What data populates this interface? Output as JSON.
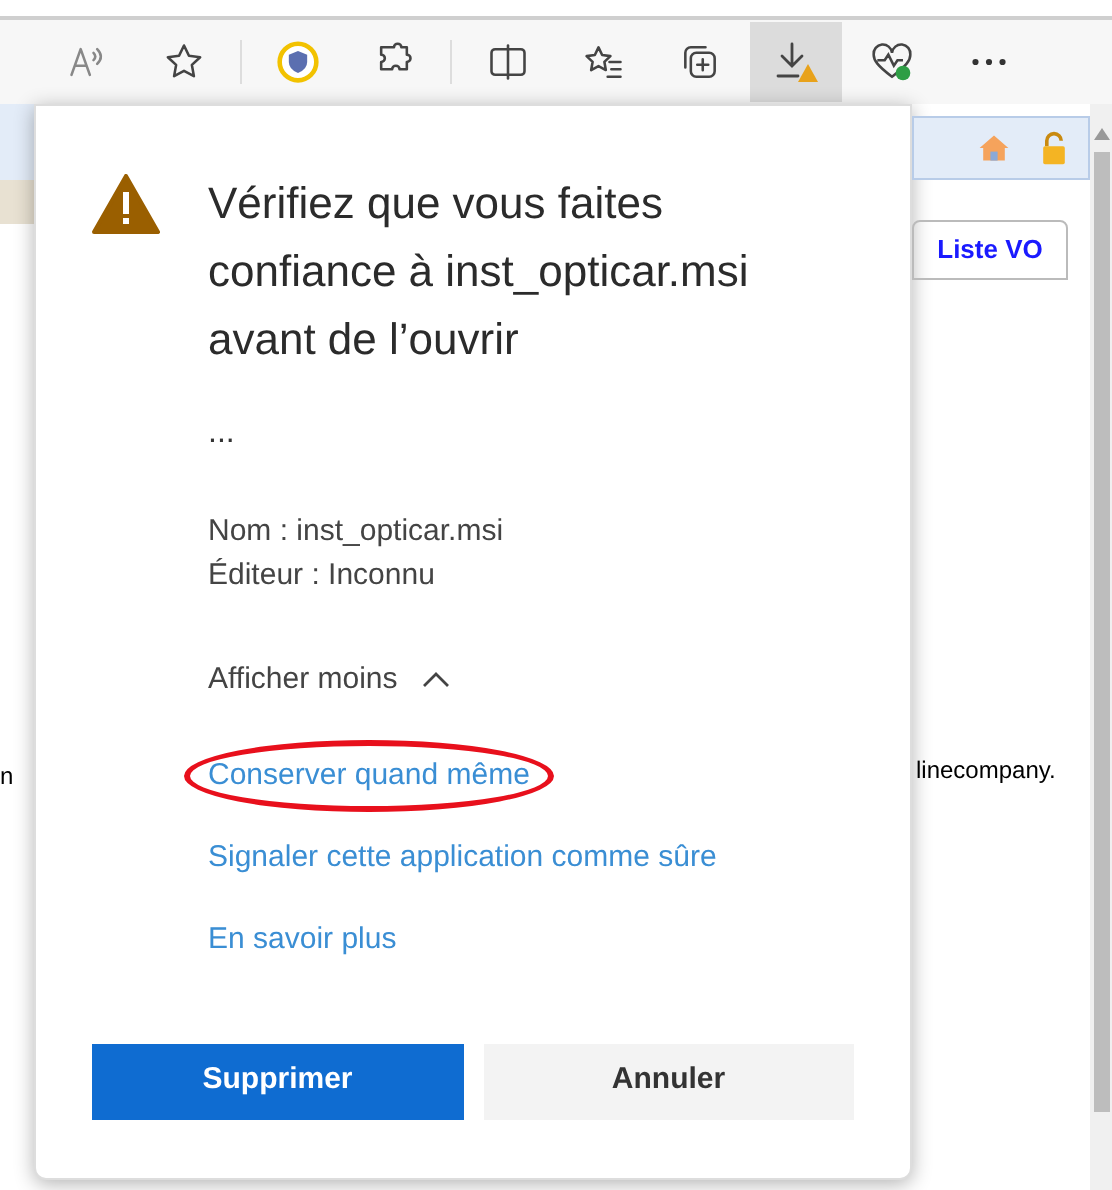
{
  "toolbar": {
    "items": [
      {
        "kind": "read-aloud",
        "selected": false
      },
      {
        "kind": "favorite",
        "selected": false
      },
      {
        "kind": "divider"
      },
      {
        "kind": "shield",
        "selected": false
      },
      {
        "kind": "extensions",
        "selected": false
      },
      {
        "kind": "divider"
      },
      {
        "kind": "split",
        "selected": false
      },
      {
        "kind": "favorites-list",
        "selected": false
      },
      {
        "kind": "collections",
        "selected": false
      },
      {
        "kind": "download",
        "selected": true
      },
      {
        "kind": "health",
        "selected": false
      },
      {
        "kind": "more",
        "selected": false
      }
    ]
  },
  "background_page": {
    "left_text": "n",
    "tab": "Liste VO",
    "right_text": "linecompany."
  },
  "dialog": {
    "title": "Vérifiez que vous faites confiance à inst_opticar.msi avant de l’ouvrir",
    "ellipsis": "...",
    "details": [
      "Nom : inst_opticar.msi",
      "Éditeur : Inconnu"
    ],
    "toggle": {
      "label": "Afficher moins",
      "expanded": true
    },
    "links": [
      {
        "label": "Conserver quand même",
        "highlighted": true
      },
      {
        "label": "Signaler cette application comme sûre",
        "highlighted": false
      },
      {
        "label": "En savoir plus",
        "highlighted": false
      }
    ],
    "buttons": [
      {
        "label": "Supprimer",
        "kind": "primary"
      },
      {
        "label": "Annuler",
        "kind": "secondary"
      }
    ]
  }
}
